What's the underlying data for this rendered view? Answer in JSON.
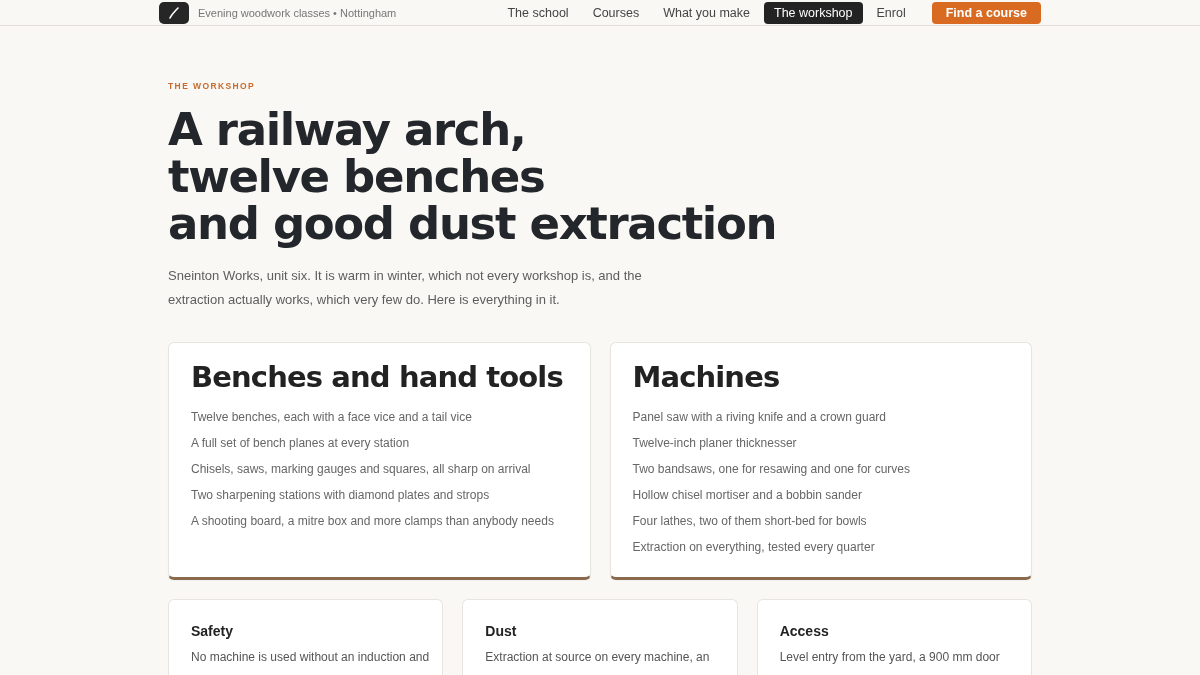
{
  "header": {
    "tagline": "Evening woodwork classes • Nottingham",
    "nav": [
      {
        "label": "The school",
        "selected": false
      },
      {
        "label": "Courses",
        "selected": false
      },
      {
        "label": "What you make",
        "selected": false
      },
      {
        "label": "The workshop",
        "selected": true
      },
      {
        "label": "Enrol",
        "selected": false
      }
    ],
    "cta_button": "Find a course"
  },
  "hero": {
    "eyebrow": "THE WORKSHOP",
    "title_lines": [
      "A railway arch,",
      "twelve benches",
      "and good dust extraction"
    ],
    "intro": "Sneinton Works, unit six. It is warm in winter, which not every workshop is, and the extraction actually works, which very few do. Here is everything in it."
  },
  "main_cards": [
    {
      "title": "Benches and hand tools",
      "items": [
        "Twelve benches, each with a face vice and a tail vice",
        "A full set of bench planes at every station",
        "Chisels, saws, marking gauges and squares, all sharp on arrival",
        "Two sharpening stations with diamond plates and strops",
        "A shooting board, a mitre box and more clamps than anybody needs"
      ]
    },
    {
      "title": "Machines",
      "items": [
        "Panel saw with a riving knife and a crown guard",
        "Twelve-inch planer thicknesser",
        "Two bandsaws, one for resawing and one for curves",
        "Hollow chisel mortiser and a bobbin sander",
        "Four lathes, two of them short-bed for bowls",
        "Extraction on everything, tested every quarter"
      ]
    }
  ],
  "detail_cards": [
    {
      "title": "Safety",
      "text": "No machine is used without an induction and"
    },
    {
      "title": "Dust",
      "text": "Extraction at source on every machine, an"
    },
    {
      "title": "Access",
      "text": "Level entry from the yard, a 900 mm door"
    }
  ]
}
